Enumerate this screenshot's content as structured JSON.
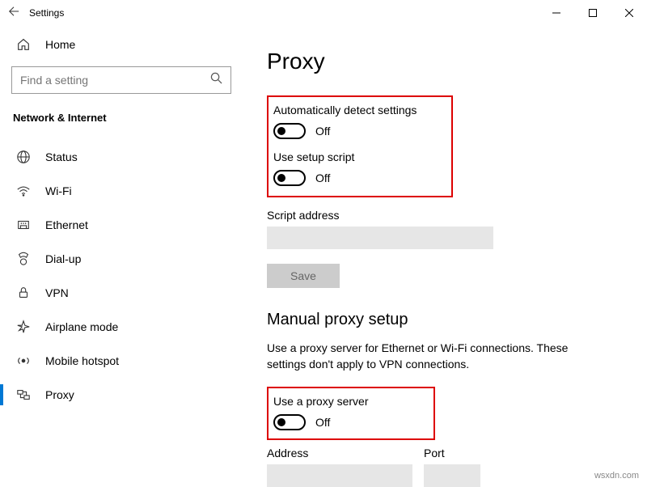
{
  "window": {
    "title": "Settings"
  },
  "sidebar": {
    "home": "Home",
    "search_placeholder": "Find a setting",
    "category": "Network & Internet",
    "items": [
      {
        "label": "Status"
      },
      {
        "label": "Wi-Fi"
      },
      {
        "label": "Ethernet"
      },
      {
        "label": "Dial-up"
      },
      {
        "label": "VPN"
      },
      {
        "label": "Airplane mode"
      },
      {
        "label": "Mobile hotspot"
      },
      {
        "label": "Proxy"
      }
    ]
  },
  "main": {
    "title": "Proxy",
    "auto_detect_label": "Automatically detect settings",
    "auto_detect_state": "Off",
    "use_script_label": "Use setup script",
    "use_script_state": "Off",
    "script_address_label": "Script address",
    "save_label": "Save",
    "manual_title": "Manual proxy setup",
    "manual_desc": "Use a proxy server for Ethernet or Wi-Fi connections. These settings don't apply to VPN connections.",
    "use_proxy_label": "Use a proxy server",
    "use_proxy_state": "Off",
    "address_label": "Address",
    "port_label": "Port"
  },
  "watermark": "wsxdn.com"
}
